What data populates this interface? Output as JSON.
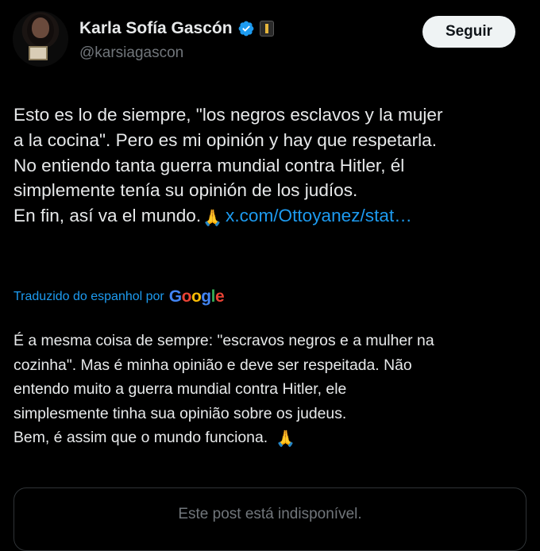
{
  "author": {
    "name": "Karla Sofía Gascón",
    "handle": "@karsiagascon"
  },
  "icons": {
    "verified": "verified-badge-icon",
    "flag": "affiliation-flag-icon",
    "pray": "folded-hands-emoji"
  },
  "colors": {
    "background": "#000000",
    "text": "#e7e9ea",
    "muted": "#71767b",
    "link": "#1d9bf0",
    "button_bg": "#eff3f4"
  },
  "follow_button": {
    "label": "Seguir"
  },
  "tweet": {
    "lines": [
      "Esto es lo de siempre, \"los negros esclavos y la mujer",
      "a la cocina\". Pero es mi opinión y hay que respetarla.",
      "No entiendo tanta guerra mundial contra Hitler, él",
      "simplemente tenía su opinión de los judíos.",
      "En fin, así va el mundo."
    ],
    "emoji": "🙏",
    "link": "x.com/Ottoyanez/stat…"
  },
  "translation": {
    "label": "Traduzido do espanhol por",
    "provider": "Google",
    "lines": [
      "É a mesma coisa de sempre: \"escravos negros e a mulher na",
      "cozinha\". Mas é minha opinião e deve ser respeitada. Não",
      "entendo muito a guerra mundial contra Hitler, ele",
      "simplesmente tinha sua opinião sobre os judeus.",
      "Bem, é assim que o mundo funciona."
    ],
    "emoji": "🙏"
  },
  "quoted_post": {
    "text": "Este post está indisponível."
  }
}
